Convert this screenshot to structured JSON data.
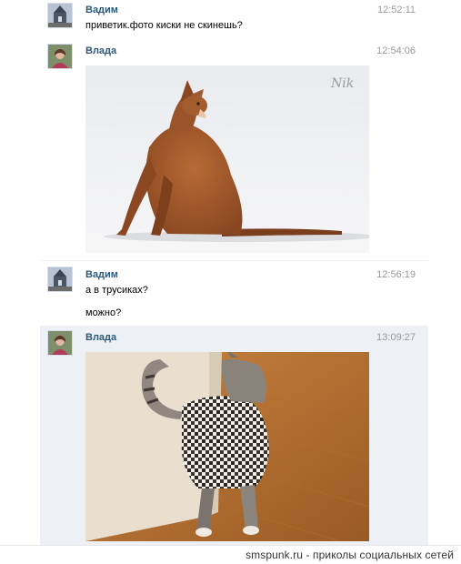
{
  "messages": [
    {
      "author": "Вадим",
      "time": "12:52:11",
      "text": "приветик.фото киски не скинешь?"
    },
    {
      "author": "Влада",
      "time": "12:54:06",
      "photo_watermark": "Nik"
    },
    {
      "author": "Вадим",
      "time": "12:56:19",
      "lines": [
        "а в трусиках?",
        "можно?"
      ]
    },
    {
      "author": "Влада",
      "time": "13:09:27"
    }
  ],
  "footer": {
    "text": "smspunk.ru - приколы социальных сетей"
  },
  "colors": {
    "author": "#2b587a",
    "time": "#999999",
    "highlight": "#edf1f5"
  }
}
